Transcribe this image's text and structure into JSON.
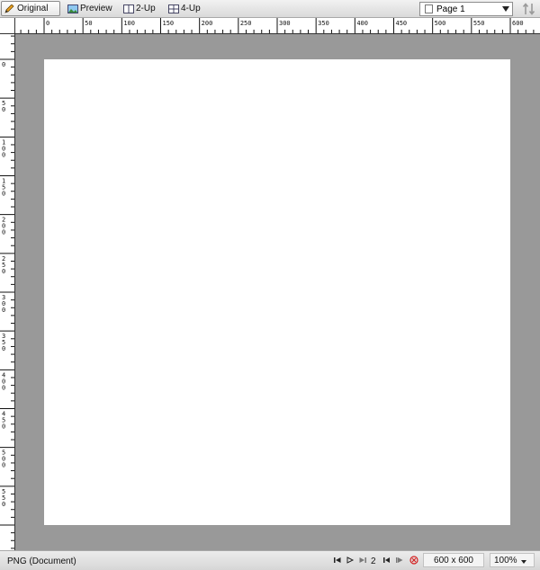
{
  "toolbar": {
    "tabs": [
      {
        "label": "Original",
        "icon": "pencil-icon"
      },
      {
        "label": "Preview",
        "icon": "image-icon"
      },
      {
        "label": "2-Up",
        "icon": "two-up-icon"
      },
      {
        "label": "4-Up",
        "icon": "four-up-icon"
      }
    ],
    "active_tab": "Original",
    "page_select": "Page 1"
  },
  "rulers": {
    "top_labels": [
      "0",
      "50",
      "100",
      "150",
      "200",
      "250",
      "300",
      "350",
      "400",
      "450",
      "500",
      "550",
      "600"
    ],
    "left_labels": [
      "0",
      "50",
      "100",
      "150",
      "200",
      "250",
      "300",
      "350",
      "400",
      "450",
      "500",
      "550"
    ]
  },
  "status": {
    "file_type": "PNG (Document)",
    "frame_number": "2",
    "dimensions": "600 x 600",
    "zoom": "100%"
  },
  "colors": {
    "canvas_bg": "#999999",
    "page_bg": "#ffffff",
    "stop_icon": "#d42020"
  }
}
